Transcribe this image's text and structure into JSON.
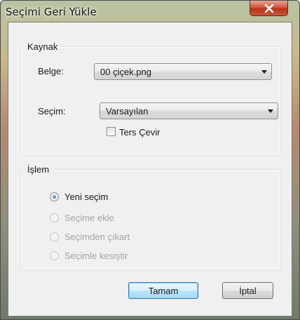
{
  "window": {
    "title": "Seçimi Geri Yükle"
  },
  "source_group": {
    "legend": "Kaynak",
    "document_label": "Belge:",
    "document_value": "00 çiçek.png",
    "selection_label": "Seçim:",
    "selection_value": "Varsayılan",
    "invert_label": "Ters Çevir",
    "invert_checked": false
  },
  "operation_group": {
    "legend": "İşlem",
    "options": [
      {
        "label": "Yeni seçim",
        "checked": true,
        "enabled": true
      },
      {
        "label": "Seçime ekle",
        "checked": false,
        "enabled": false
      },
      {
        "label": "Seçimden çıkart",
        "checked": false,
        "enabled": false
      },
      {
        "label": "Seçimle kesiştir",
        "checked": false,
        "enabled": false
      }
    ]
  },
  "buttons": {
    "ok": "Tamam",
    "cancel": "İptal"
  },
  "icons": {
    "close": "close-icon",
    "dropdown": "chevron-down-icon"
  },
  "colors": {
    "close_button": "#c94a30",
    "default_button_border": "#3c7fb1",
    "dialog_background": "#f0f0f0"
  }
}
